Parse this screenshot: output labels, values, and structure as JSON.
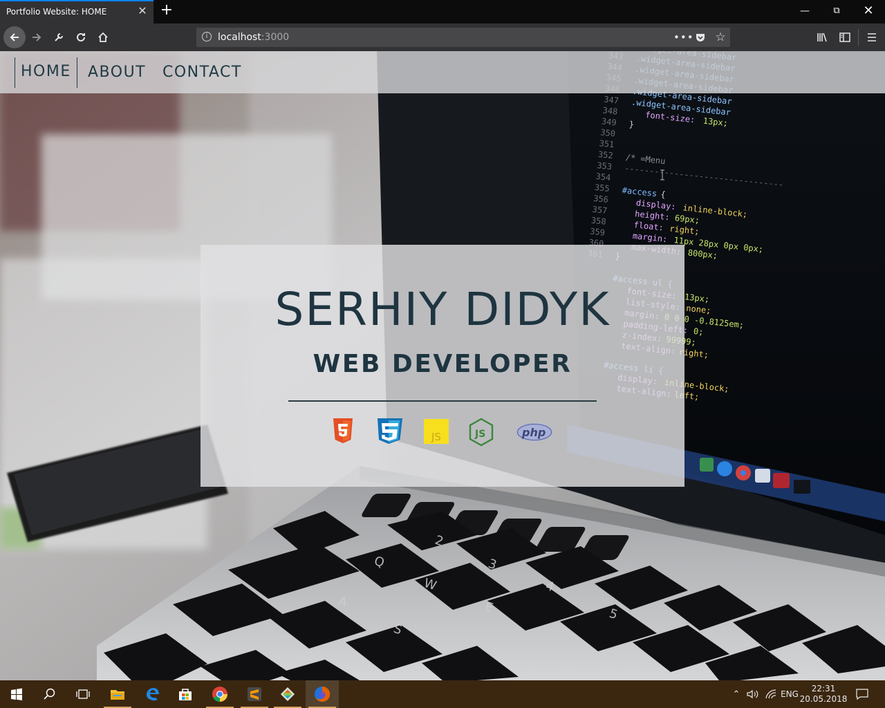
{
  "browser": {
    "tab_title": "Portfolio Website: HOME",
    "url_host": "localhost",
    "url_port": ":3000",
    "new_tab": "+",
    "tab_close": "✕"
  },
  "site": {
    "nav": [
      {
        "label": "HOME",
        "active": true
      },
      {
        "label": "ABOUT",
        "active": false
      },
      {
        "label": "CONTACT",
        "active": false
      }
    ],
    "hero": {
      "name": "SERHIY DIDYK",
      "role": "WEB DEVELOPER",
      "tech_icons": [
        "html5-icon",
        "css3-icon",
        "javascript-icon",
        "nodejs-icon",
        "php-icon"
      ]
    }
  },
  "taskbar": {
    "apps": [
      "start-icon",
      "search-icon",
      "task-view-icon",
      "file-explorer-icon",
      "edge-icon",
      "store-icon",
      "chrome-icon",
      "sublime-icon",
      "git-icon",
      "firefox-icon"
    ],
    "language": "ENG",
    "time": "22:31",
    "date": "20.05.2018"
  },
  "colors": {
    "accent": "#0a84ff",
    "hero_text": "#1e3540",
    "taskbar": "#3b2710"
  }
}
